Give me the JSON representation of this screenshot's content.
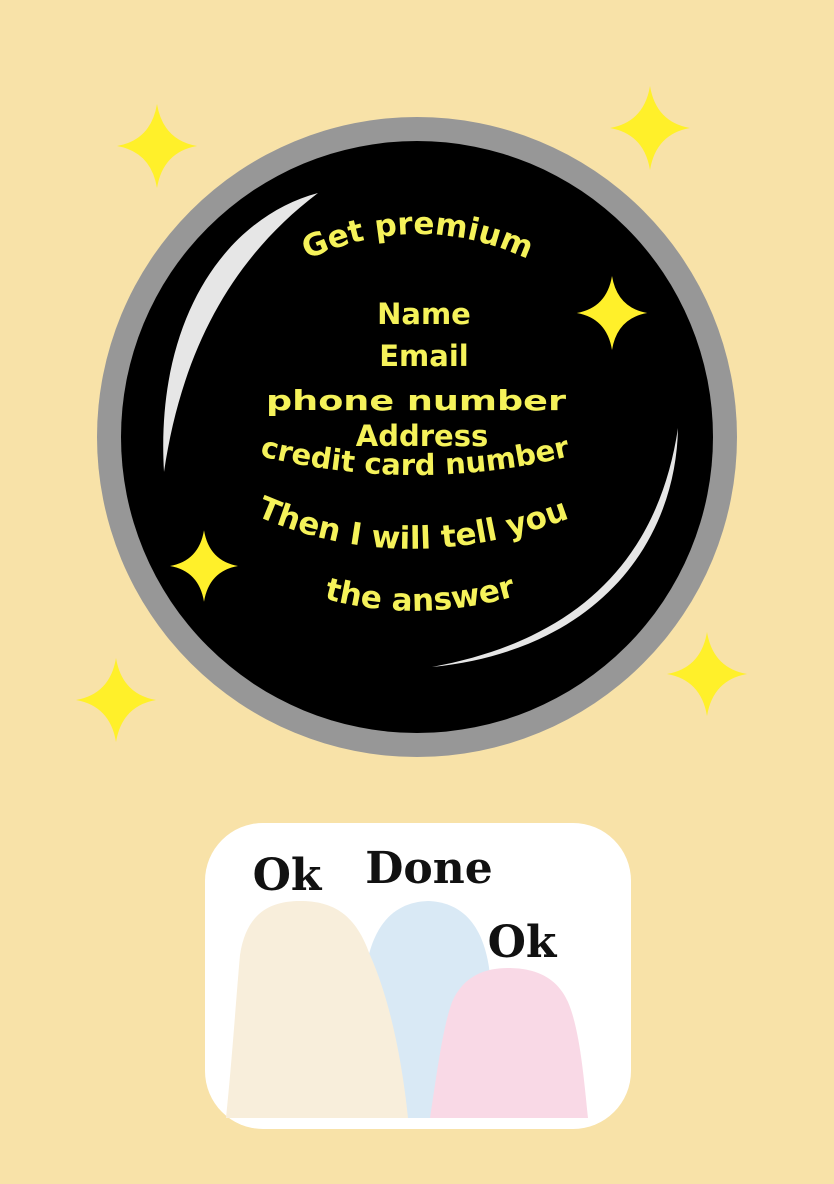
{
  "colors": {
    "background": "#f8e2a8",
    "frame_ring": "#979797",
    "ball": "#000000",
    "ball_text": "#f5f25a",
    "sparkle": "#fff02a",
    "highlight": "#e6e6e6",
    "panel": "#ffffff",
    "figure_left": "#f8eedb",
    "figure_middle": "#d9e9f5",
    "figure_right": "#f9d9e6"
  },
  "crystal_ball": {
    "title": "Get premium",
    "fields": [
      "Name",
      "Email",
      "phone number",
      "Address",
      "credit card number"
    ],
    "promise_line1": "Then I will tell you",
    "promise_line2": "the answer"
  },
  "sparkles": [
    "sparkle-icon",
    "sparkle-icon",
    "sparkle-icon",
    "sparkle-icon",
    "sparkle-icon",
    "sparkle-icon"
  ],
  "audience": {
    "left_reply": "Ok",
    "middle_reply": "Done",
    "right_reply": "Ok"
  }
}
